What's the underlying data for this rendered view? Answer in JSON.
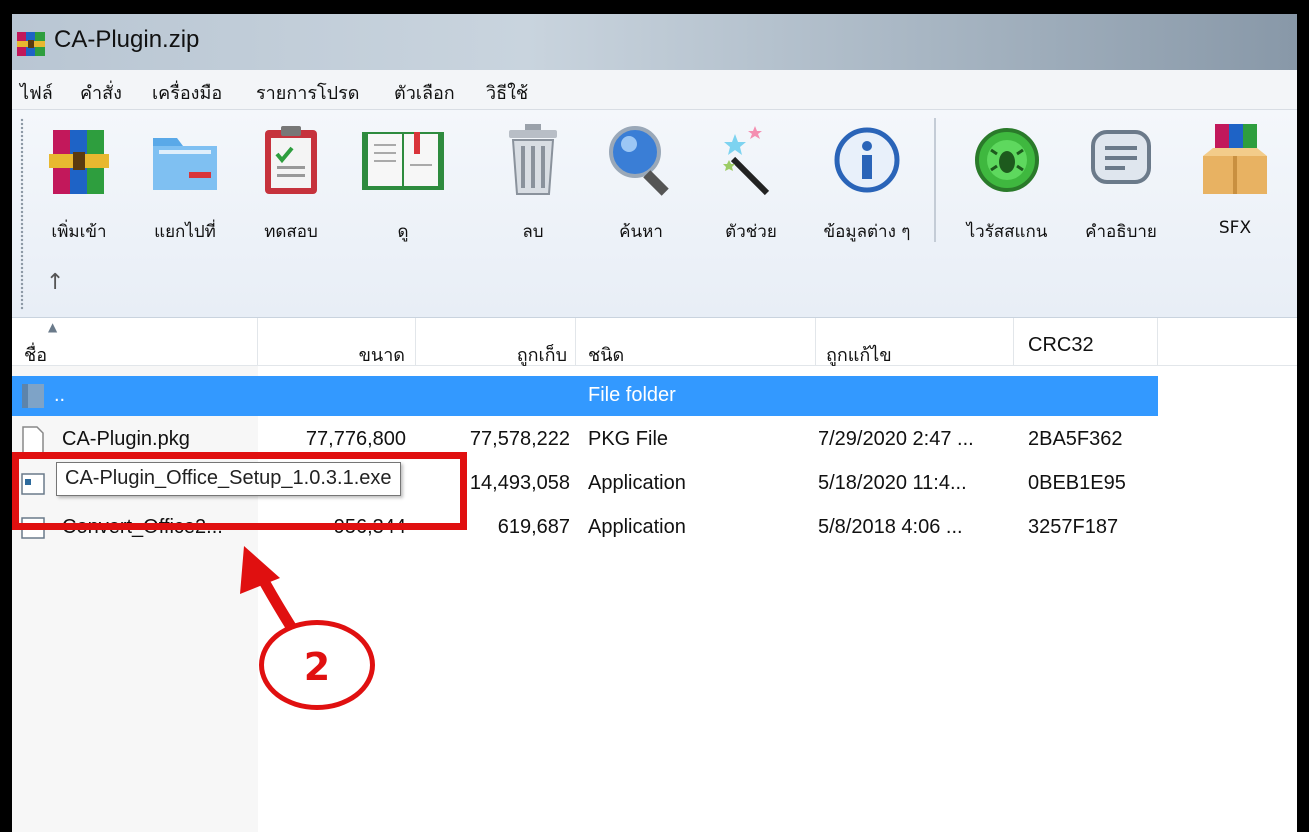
{
  "window": {
    "title": "CA-Plugin.zip"
  },
  "menu": {
    "items": [
      "ไฟล์",
      "คำสั่ง",
      "เครื่องมือ",
      "รายการโปรด",
      "ตัวเลือก",
      "วิธีใช้"
    ]
  },
  "toolbar": {
    "buttons": [
      {
        "label": "เพิ่มเข้า",
        "icon": "winrar-archive-icon"
      },
      {
        "label": "แยกไปที่",
        "icon": "folder-extract-icon"
      },
      {
        "label": "ทดสอบ",
        "icon": "clipboard-test-icon"
      },
      {
        "label": "ดู",
        "icon": "book-view-icon"
      },
      {
        "label": "ลบ",
        "icon": "trash-bin-icon"
      },
      {
        "label": "ค้นหา",
        "icon": "magnifier-icon"
      },
      {
        "label": "ตัวช่วย",
        "icon": "magic-wand-icon"
      },
      {
        "label": "ข้อมูลต่าง ๆ",
        "icon": "info-icon"
      },
      {
        "label": "ไวรัสสแกน",
        "icon": "virus-scan-icon"
      },
      {
        "label": "คำอธิบาย",
        "icon": "comment-icon"
      },
      {
        "label": "SFX",
        "icon": "sfx-box-icon"
      }
    ],
    "up_arrow": "↑"
  },
  "columns": {
    "name": "ชื่อ",
    "size": "ขนาด",
    "packed": "ถูกเก็บ",
    "type": "ชนิด",
    "modified": "ถูกแก้ไข",
    "crc": "CRC32"
  },
  "rows": [
    {
      "name": "..",
      "size": "",
      "packed": "",
      "type": "File folder",
      "modified": "",
      "crc": ""
    },
    {
      "name": "CA-Plugin.pkg",
      "size": "77,776,800",
      "packed": "77,578,222",
      "type": "PKG File",
      "modified": "7/29/2020 2:47 ...",
      "crc": "2BA5F362"
    },
    {
      "name": "CA-Plugin_Office_Setup_1.0.3.1.exe",
      "size": "",
      "packed": "14,493,058",
      "type": "Application",
      "modified": "5/18/2020 11:4...",
      "crc": "0BEB1E95"
    },
    {
      "name": "Convert_Office2...",
      "size": "956,344",
      "packed": "619,687",
      "type": "Application",
      "modified": "5/8/2018 4:06 ...",
      "crc": "3257F187"
    }
  ],
  "tooltip": "CA-Plugin_Office_Setup_1.0.3.1.exe",
  "annotation": {
    "step": "2",
    "color": "#e01010"
  },
  "colors": {
    "selection": "#3399ff"
  }
}
